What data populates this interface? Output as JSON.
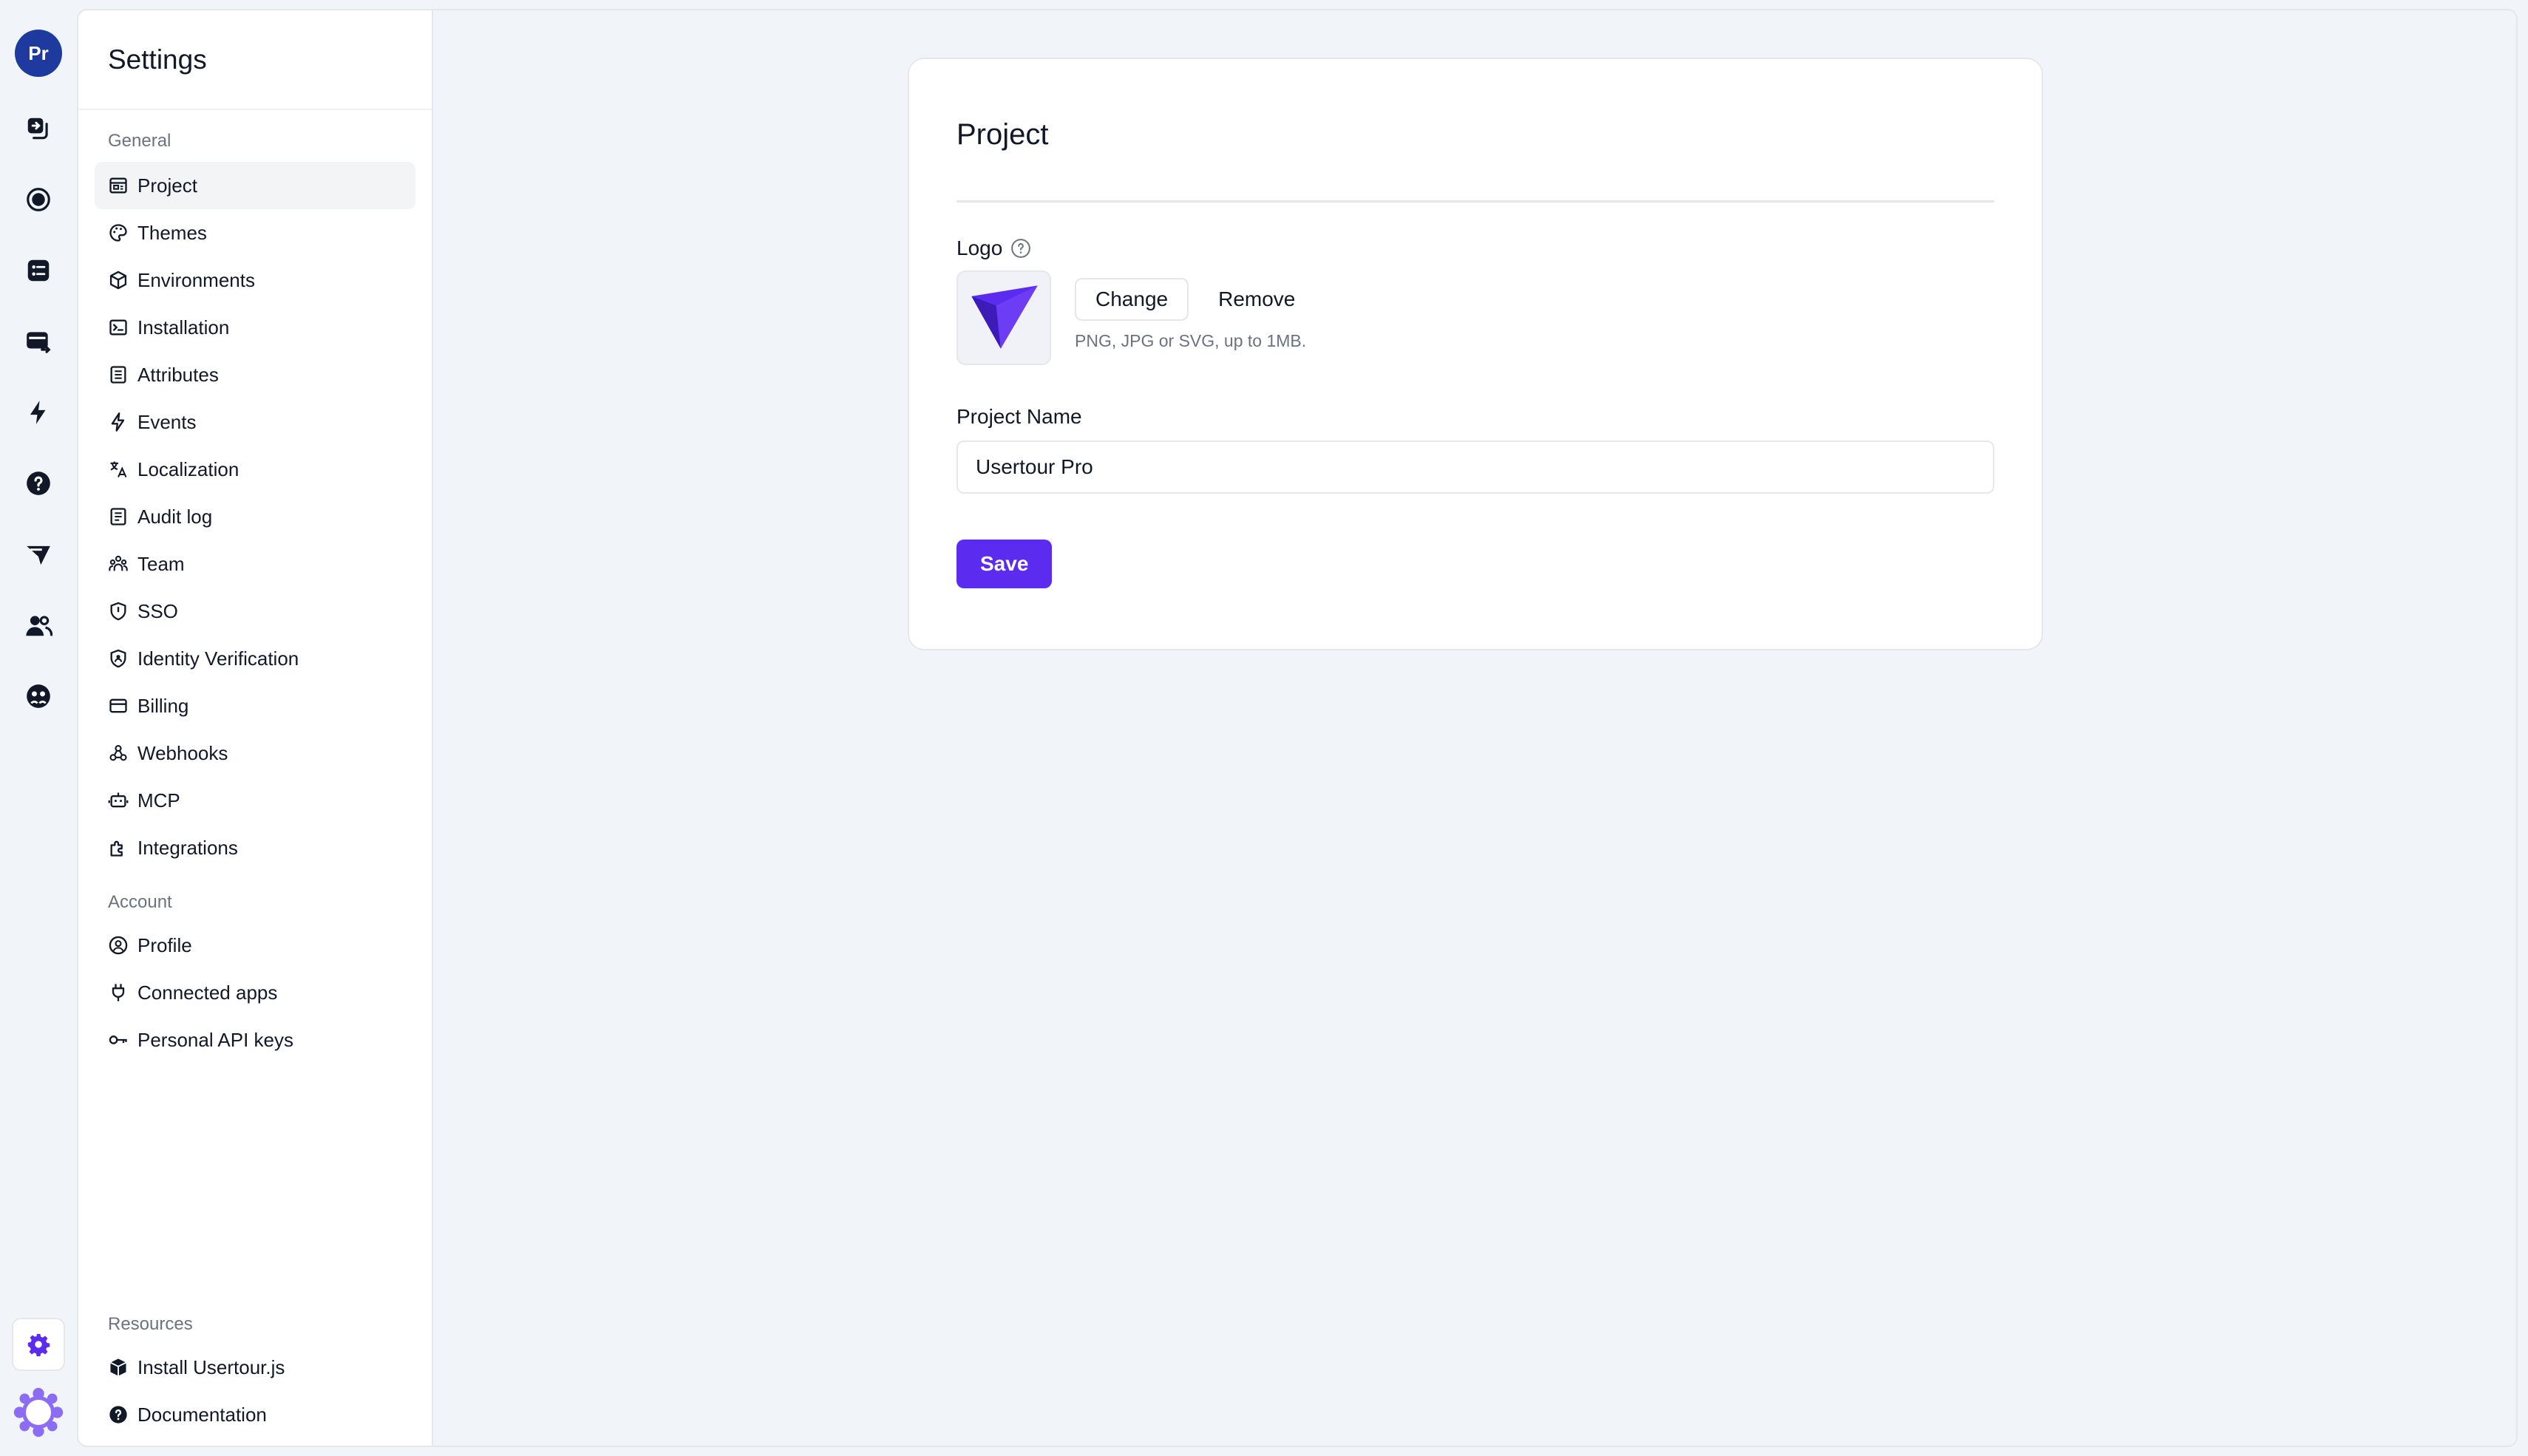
{
  "rail": {
    "avatar_initials": "Pr",
    "items": [
      {
        "icon": "flows-icon"
      },
      {
        "icon": "checklists-icon"
      },
      {
        "icon": "launchers-icon"
      },
      {
        "icon": "banners-icon"
      },
      {
        "icon": "events-icon"
      },
      {
        "icon": "help-icon"
      },
      {
        "icon": "surveys-icon"
      },
      {
        "icon": "users-icon"
      },
      {
        "icon": "companies-icon"
      }
    ],
    "settings_icon": "gear-icon",
    "brand_icon": "usertour-logo-icon"
  },
  "sidebar": {
    "title": "Settings",
    "general_label": "General",
    "general_items": [
      {
        "label": "Project",
        "icon": "project-icon",
        "active": true
      },
      {
        "label": "Themes",
        "icon": "palette-icon"
      },
      {
        "label": "Environments",
        "icon": "cube-icon"
      },
      {
        "label": "Installation",
        "icon": "terminal-icon"
      },
      {
        "label": "Attributes",
        "icon": "list-icon"
      },
      {
        "label": "Events",
        "icon": "bolt-icon"
      },
      {
        "label": "Localization",
        "icon": "translate-icon"
      },
      {
        "label": "Audit log",
        "icon": "document-icon"
      },
      {
        "label": "Team",
        "icon": "team-icon"
      },
      {
        "label": "SSO",
        "icon": "shield-icon"
      },
      {
        "label": "Identity Verification",
        "icon": "shield-user-icon"
      },
      {
        "label": "Billing",
        "icon": "card-icon"
      },
      {
        "label": "Webhooks",
        "icon": "webhook-icon"
      },
      {
        "label": "MCP",
        "icon": "robot-icon"
      },
      {
        "label": "Integrations",
        "icon": "puzzle-icon"
      }
    ],
    "account_label": "Account",
    "account_items": [
      {
        "label": "Profile",
        "icon": "user-circle-icon"
      },
      {
        "label": "Connected apps",
        "icon": "plug-icon"
      },
      {
        "label": "Personal API keys",
        "icon": "key-icon"
      }
    ],
    "resources_label": "Resources",
    "resources_items": [
      {
        "label": "Install Usertour.js",
        "icon": "package-icon"
      },
      {
        "label": "Documentation",
        "icon": "question-icon"
      }
    ]
  },
  "main": {
    "card_title": "Project",
    "logo_label": "Logo",
    "change_label": "Change",
    "remove_label": "Remove",
    "logo_hint": "PNG, JPG or SVG, up to 1MB.",
    "project_name_label": "Project Name",
    "project_name_value": "Usertour Pro",
    "save_label": "Save"
  },
  "colors": {
    "accent": "#5b2bf0",
    "avatar": "#1e3a9e",
    "background": "#f1f4f9"
  }
}
